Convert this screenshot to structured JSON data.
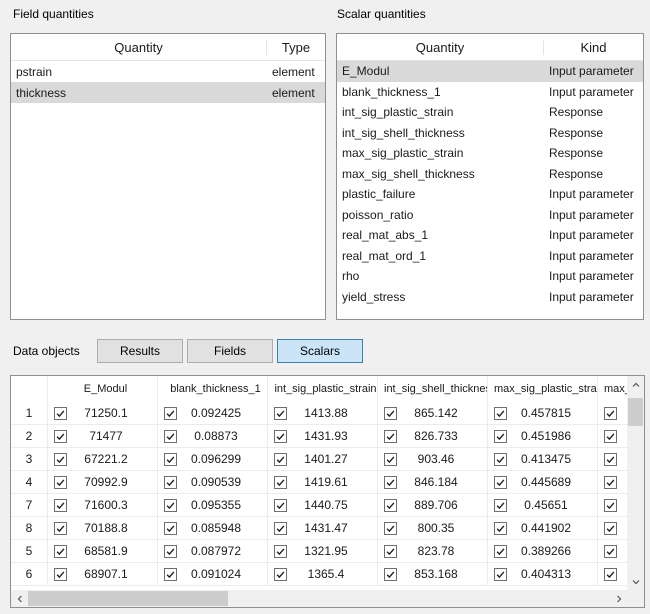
{
  "field_quantities": {
    "label": "Field quantities",
    "columns": {
      "quantity": "Quantity",
      "type": "Type"
    },
    "rows": [
      {
        "quantity": "pstrain",
        "type": "element",
        "selected": false
      },
      {
        "quantity": "thickness",
        "type": "element",
        "selected": true
      }
    ]
  },
  "scalar_quantities": {
    "label": "Scalar quantities",
    "columns": {
      "quantity": "Quantity",
      "kind": "Kind"
    },
    "rows": [
      {
        "quantity": "E_Modul",
        "kind": "Input parameter",
        "selected": true
      },
      {
        "quantity": "blank_thickness_1",
        "kind": "Input parameter",
        "selected": false
      },
      {
        "quantity": "int_sig_plastic_strain",
        "kind": "Response",
        "selected": false
      },
      {
        "quantity": "int_sig_shell_thickness",
        "kind": "Response",
        "selected": false
      },
      {
        "quantity": "max_sig_plastic_strain",
        "kind": "Response",
        "selected": false
      },
      {
        "quantity": "max_sig_shell_thickness",
        "kind": "Response",
        "selected": false
      },
      {
        "quantity": "plastic_failure",
        "kind": "Input parameter",
        "selected": false
      },
      {
        "quantity": "poisson_ratio",
        "kind": "Input parameter",
        "selected": false
      },
      {
        "quantity": "real_mat_abs_1",
        "kind": "Input parameter",
        "selected": false
      },
      {
        "quantity": "real_mat_ord_1",
        "kind": "Input parameter",
        "selected": false
      },
      {
        "quantity": "rho",
        "kind": "Input parameter",
        "selected": false
      },
      {
        "quantity": "yield_stress",
        "kind": "Input parameter",
        "selected": false
      }
    ]
  },
  "data_objects": {
    "label": "Data objects",
    "buttons": [
      {
        "label": "Results",
        "active": false
      },
      {
        "label": "Fields",
        "active": false
      },
      {
        "label": "Scalars",
        "active": true
      }
    ]
  },
  "data_table": {
    "columns": [
      "E_Modul",
      "blank_thickness_1",
      "int_sig_plastic_strain",
      "int_sig_shell_thickness",
      "max_sig_plastic_strain",
      "max_sig_shell_thickness"
    ],
    "all_checked": true,
    "rows": [
      {
        "index": "1",
        "values": [
          "71250.1",
          "0.092425",
          "1413.88",
          "865.142",
          "0.457815",
          ""
        ]
      },
      {
        "index": "2",
        "values": [
          "71477",
          "0.08873",
          "1431.93",
          "826.733",
          "0.451986",
          ""
        ]
      },
      {
        "index": "3",
        "values": [
          "67221.2",
          "0.096299",
          "1401.27",
          "903.46",
          "0.413475",
          ""
        ]
      },
      {
        "index": "4",
        "values": [
          "70992.9",
          "0.090539",
          "1419.61",
          "846.184",
          "0.445689",
          ""
        ]
      },
      {
        "index": "7",
        "values": [
          "71600.3",
          "0.095355",
          "1440.75",
          "889.706",
          "0.45651",
          ""
        ]
      },
      {
        "index": "8",
        "values": [
          "70188.8",
          "0.085948",
          "1431.47",
          "800.35",
          "0.441902",
          ""
        ]
      },
      {
        "index": "5",
        "values": [
          "68581.9",
          "0.087972",
          "1321.95",
          "823.78",
          "0.389266",
          ""
        ]
      },
      {
        "index": "6",
        "values": [
          "68907.1",
          "0.091024",
          "1365.4",
          "853.168",
          "0.404313",
          ""
        ]
      }
    ]
  },
  "colors": {
    "selection": "#d9d9d9",
    "accent_fill": "#cce4f7",
    "accent_border": "#3c7fb1"
  }
}
